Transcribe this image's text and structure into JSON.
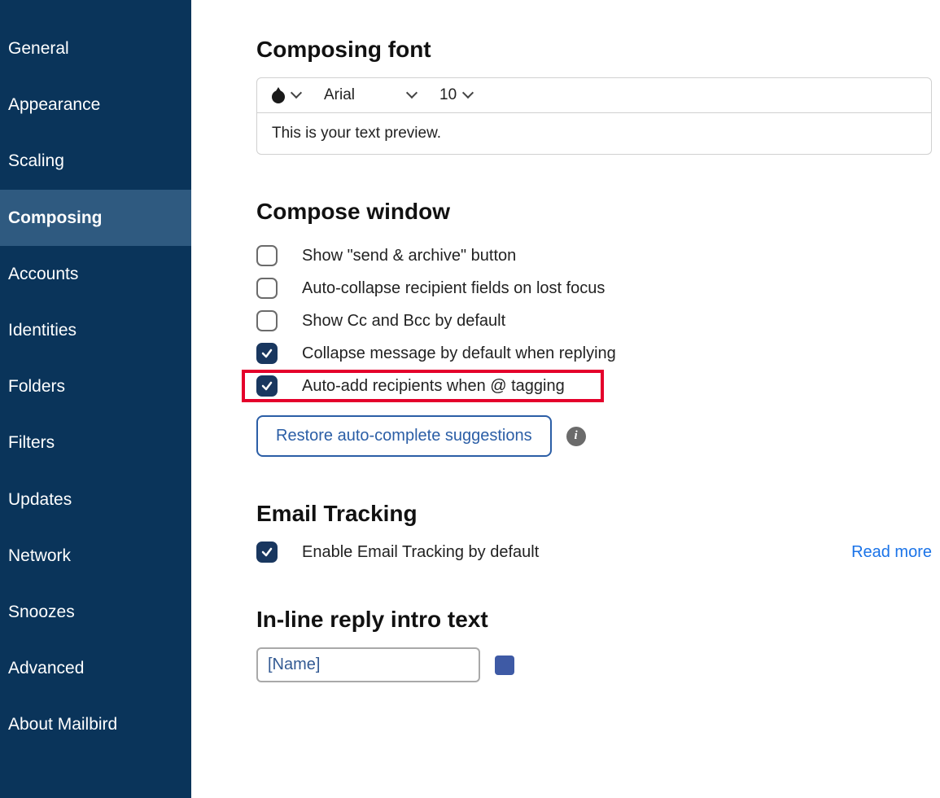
{
  "sidebar": {
    "items": [
      {
        "label": "General",
        "active": false
      },
      {
        "label": "Appearance",
        "active": false
      },
      {
        "label": "Scaling",
        "active": false
      },
      {
        "label": "Composing",
        "active": true
      },
      {
        "label": "Accounts",
        "active": false
      },
      {
        "label": "Identities",
        "active": false
      },
      {
        "label": "Folders",
        "active": false
      },
      {
        "label": "Filters",
        "active": false
      },
      {
        "label": "Updates",
        "active": false
      },
      {
        "label": "Network",
        "active": false
      },
      {
        "label": "Snoozes",
        "active": false
      },
      {
        "label": "Advanced",
        "active": false
      },
      {
        "label": "About Mailbird",
        "active": false
      }
    ]
  },
  "composing_font": {
    "title": "Composing font",
    "font_family": "Arial",
    "font_size": "10",
    "preview_text": "This is your text preview."
  },
  "compose_window": {
    "title": "Compose window",
    "options": [
      {
        "label": "Show \"send & archive\" button",
        "checked": false
      },
      {
        "label": "Auto-collapse recipient fields on lost focus",
        "checked": false
      },
      {
        "label": "Show Cc and Bcc by default",
        "checked": false
      },
      {
        "label": "Collapse message by default when replying",
        "checked": true
      },
      {
        "label": "Auto-add recipients when @ tagging",
        "checked": true,
        "highlighted": true
      }
    ],
    "restore_button": "Restore auto-complete suggestions"
  },
  "email_tracking": {
    "title": "Email Tracking",
    "option_label": "Enable Email Tracking by default",
    "option_checked": true,
    "read_more": "Read more"
  },
  "inline_reply": {
    "title": "In-line reply intro text",
    "value": "[Name]"
  }
}
